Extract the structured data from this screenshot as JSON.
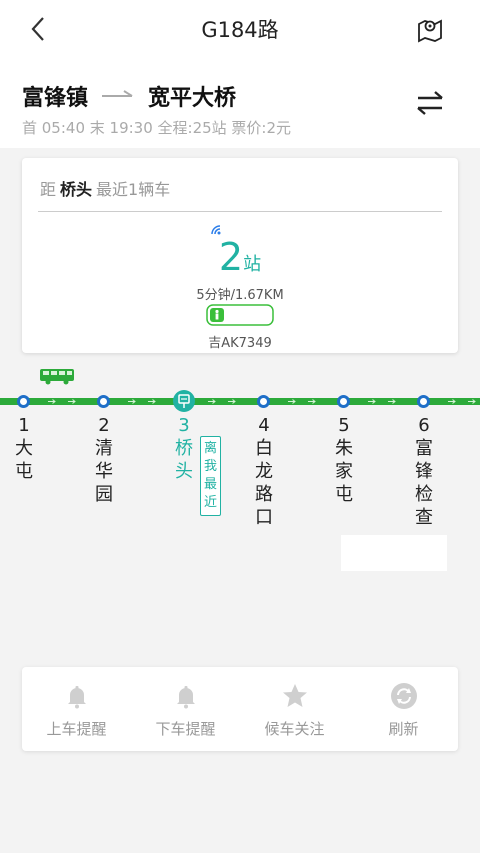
{
  "header": {
    "title": "G184路",
    "back_icon": "back-chevron-icon",
    "map_icon": "map-pin-icon"
  },
  "route": {
    "from": "富锋镇",
    "to": "宽平大桥",
    "meta": "首 05:40 末 19:30 全程:25站  票价:2元",
    "swap_icon": "swap-direction-icon"
  },
  "card": {
    "dist_prefix": "距",
    "station": "桥头",
    "dist_suffix": "最近1辆车",
    "stops_num": "2",
    "stops_unit": "站",
    "eta": "5分钟/1.67KM",
    "plate": "吉AK7349"
  },
  "stations": [
    {
      "no": "1",
      "name": "大屯"
    },
    {
      "no": "2",
      "name": "清华园"
    },
    {
      "no": "3",
      "name": "桥头"
    },
    {
      "no": "4",
      "name": "白龙路口"
    },
    {
      "no": "5",
      "name": "朱家屯"
    },
    {
      "no": "6",
      "name": "富锋检查"
    }
  ],
  "current_index": 2,
  "nearest_tag": "离我最近",
  "actions": [
    {
      "label": "上车提醒",
      "icon": "bell-icon"
    },
    {
      "label": "下车提醒",
      "icon": "bell-icon"
    },
    {
      "label": "候车关注",
      "icon": "star-icon"
    },
    {
      "label": "刷新",
      "icon": "refresh-icon"
    }
  ],
  "colors": {
    "accent": "#21b2a3",
    "line": "#2caa3a",
    "stop_ring": "#1e6ec8"
  }
}
